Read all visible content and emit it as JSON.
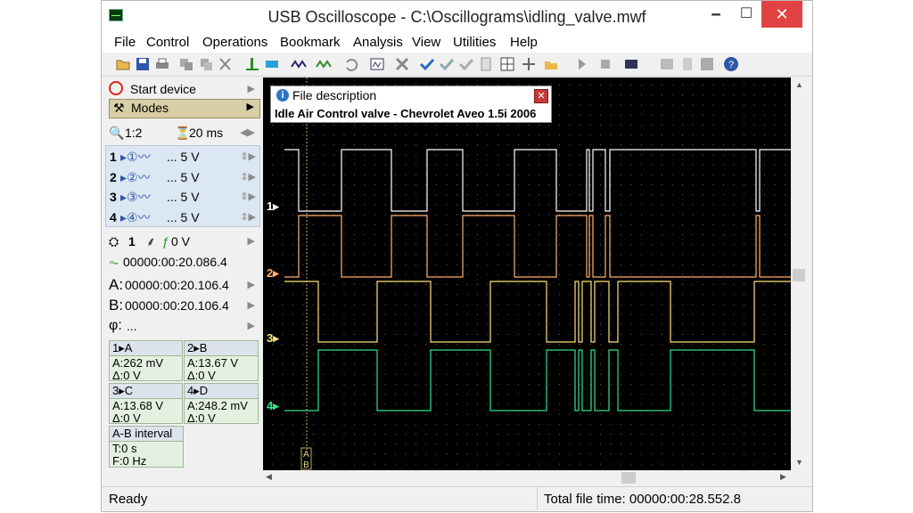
{
  "window": {
    "title": "USB Oscilloscope - C:\\Oscillograms\\idling_valve.mwf",
    "min_glyph": "🗕",
    "max_glyph": "☐",
    "close_glyph": "✕"
  },
  "menu": [
    "File",
    "Control",
    "Operations",
    "Bookmark",
    "Analysis",
    "View",
    "Utilities",
    "Help"
  ],
  "left_panel": {
    "start_device": "Start device",
    "modes": "Modes",
    "zoom": "1:2",
    "timebase": "20 ms",
    "channels": [
      {
        "num": "1",
        "value": "... 5 V"
      },
      {
        "num": "2",
        "value": "... 5 V"
      },
      {
        "num": "3",
        "value": "... 5 V"
      },
      {
        "num": "4",
        "value": "... 5 V"
      }
    ],
    "trigger_channel": "1",
    "trigger_level": "0 V",
    "trigger_time": "00000:00:20.086.4",
    "cursor_a": "00000:00:20.106.4",
    "cursor_b": "00000:00:20.106.4",
    "cursor_a_label": "A:",
    "cursor_b_label": "B:",
    "phi_label": "φ:",
    "phi_value": "...",
    "measurements": [
      {
        "head": "1▸A",
        "a": "A:262 mV",
        "d": "Δ:0 V"
      },
      {
        "head": "2▸B",
        "a": "A:13.67 V",
        "d": "Δ:0 V"
      },
      {
        "head": "3▸C",
        "a": "A:13.68 V",
        "d": "Δ:0 V"
      },
      {
        "head": "4▸D",
        "a": "A:248.2 mV",
        "d": "Δ:0 V"
      }
    ],
    "interval": {
      "head": "A-B interval",
      "t": "T:0 s",
      "f": "F:0 Hz"
    }
  },
  "file_description": {
    "title": "File description",
    "text": "Idle Air Control valve - Chevrolet Aveo 1.5i 2006"
  },
  "scope": {
    "channel_labels": [
      "1",
      "2",
      "3",
      "4"
    ],
    "channel_colors": [
      "#ffffff",
      "#ffb070",
      "#ffe27a",
      "#33e08a"
    ],
    "cursor_labels": [
      "A",
      "B"
    ]
  },
  "status": {
    "left": "Ready",
    "right": "Total file time: 00000:00:28.552.8"
  }
}
